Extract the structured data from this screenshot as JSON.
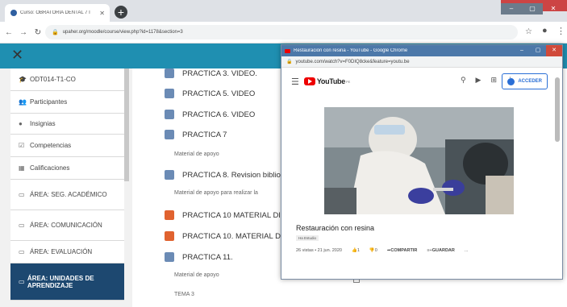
{
  "browser": {
    "tab_title": "Curso: OBRATORIA DENTAL 7 I",
    "url": "upaher.org/moodle/course/view.php?id=1178&section=3"
  },
  "sidebar": {
    "items": [
      {
        "label": "ODT014-T1-CO",
        "icon": "graduation-icon"
      },
      {
        "label": "Participantes",
        "icon": "users-icon"
      },
      {
        "label": "Insignias",
        "icon": "badge-icon"
      },
      {
        "label": "Competencias",
        "icon": "checkbox-icon"
      },
      {
        "label": "Calificaciones",
        "icon": "grades-icon"
      },
      {
        "label": "ÁREA: SEG. ACADÉMICO",
        "icon": "folder-icon"
      },
      {
        "label": "ÁREA: COMUNICACIÓN",
        "icon": "folder-icon"
      },
      {
        "label": "ÁREA: EVALUACIÓN",
        "icon": "folder-icon"
      },
      {
        "label": "ÁREA: UNIDADES DE APRENDIZAJE",
        "icon": "folder-icon"
      }
    ]
  },
  "content": {
    "rows": [
      {
        "label": "PRACTICA 3. VIDEO.",
        "type": "doc"
      },
      {
        "label": "PRACTICA 5. VIDEO",
        "type": "doc"
      },
      {
        "label": "PRACTICA 6. VIDEO",
        "type": "doc"
      },
      {
        "label": "PRACTICA 7",
        "type": "doc"
      },
      {
        "label": "Material de apoyo",
        "type": "sub"
      },
      {
        "label": "PRACTICA 8. Revision biblio",
        "type": "doc"
      },
      {
        "label": "Material de apoyo para realizar la",
        "type": "sub"
      },
      {
        "label": "PRACTICA 10 MATERIAL DI",
        "type": "pdf"
      },
      {
        "label": "PRACTICA 10. MATERIAL D",
        "type": "pdf"
      },
      {
        "label": "PRACTICA 11.",
        "type": "doc"
      },
      {
        "label": "Material de apoyo",
        "type": "sub"
      },
      {
        "label": "TEMA 3",
        "type": "sub"
      }
    ]
  },
  "popup": {
    "window_title": "Restauración con resina - YouTube - Google Chrome",
    "url": "youtube.com/watch?v=F0DIQ8cke&feature=youtu.be",
    "account_button": "ACCEDER",
    "video_title": "Restauración con resina",
    "channel_tag": "Ha Estudio",
    "views_date": "26 vistas • 21 jun. 2020",
    "likes": "1",
    "dislikes": "0",
    "share": "COMPARTIR",
    "save": "GUARDAR",
    "more": "..."
  }
}
